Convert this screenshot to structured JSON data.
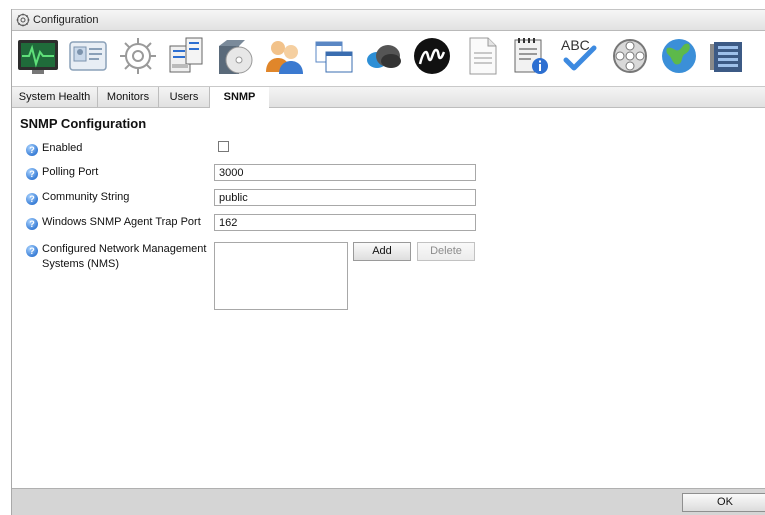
{
  "window": {
    "title": "Configuration"
  },
  "toolbar": {
    "icons": [
      "system-health-icon",
      "contact-card-icon",
      "gear-icon",
      "server-rack-icon",
      "software-disc-icon",
      "users-icon",
      "windows-icon",
      "cloud-icon",
      "m-logo-icon",
      "document-icon",
      "notepad-info-icon",
      "spellcheck-icon",
      "film-reel-icon",
      "globe-icon",
      "network-panel-icon"
    ]
  },
  "tabs": [
    {
      "label": "System Health",
      "active": false
    },
    {
      "label": "Monitors",
      "active": false
    },
    {
      "label": "Users",
      "active": false
    },
    {
      "label": "SNMP",
      "active": true
    }
  ],
  "snmp": {
    "heading": "SNMP Configuration",
    "enabled_label": "Enabled",
    "enabled": false,
    "polling_port_label": "Polling Port",
    "polling_port_value": "3000",
    "community_label": "Community String",
    "community_value": "public",
    "trap_port_label": "Windows SNMP Agent Trap Port",
    "trap_port_value": "162",
    "nms_label_line1": "Configured Network Management",
    "nms_label_line2": "Systems (NMS)",
    "nms_entries": [],
    "add_label": "Add",
    "delete_label": "Delete"
  },
  "footer": {
    "ok_label": "OK"
  },
  "colors": {
    "help_icon": "#3a7ed6",
    "health_screen": "#1f6b3a",
    "health_wave": "#5fe07a"
  }
}
